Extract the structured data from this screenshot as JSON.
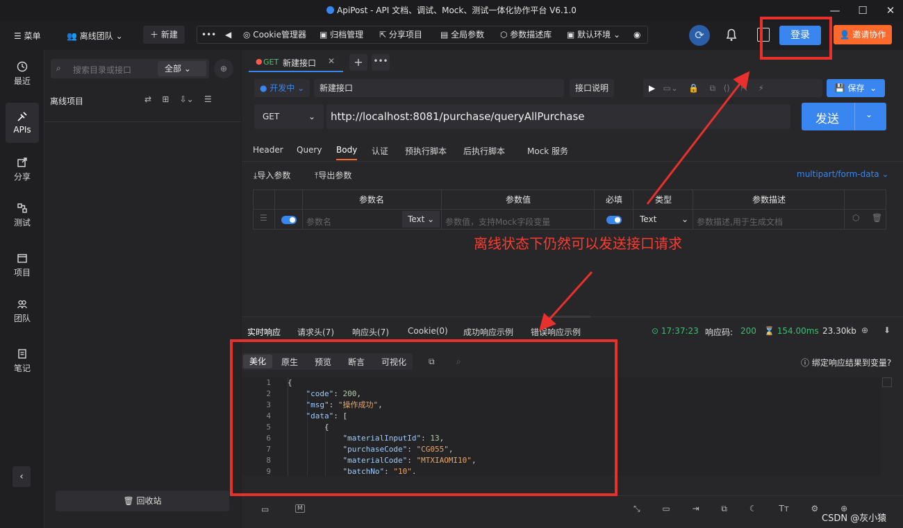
{
  "window": {
    "title": "ApiPost - API 文档、调试、Mock、测试一体化协作平台 V6.1.0"
  },
  "topbar": {
    "menu": "菜单",
    "team": "离线团队",
    "new": "新建",
    "tools": [
      "Cookie管理器",
      "归档管理",
      "分享项目",
      "全局参数",
      "参数描述库",
      "默认环境"
    ],
    "login": "登录",
    "invite": "邀请协作"
  },
  "nav": [
    {
      "label": "最近",
      "icon": "clock-icon"
    },
    {
      "label": "APIs",
      "icon": "apis-icon"
    },
    {
      "label": "分享",
      "icon": "share-icon"
    },
    {
      "label": "测试",
      "icon": "test-icon"
    },
    {
      "label": "项目",
      "icon": "project-icon"
    },
    {
      "label": "团队",
      "icon": "team-icon"
    },
    {
      "label": "笔记",
      "icon": "note-icon"
    }
  ],
  "sidebar": {
    "search_placeholder": "搜索目录或接口",
    "filter": "全部",
    "project": "离线项目",
    "recycle": "回收站"
  },
  "tab": {
    "method": "GET",
    "name": "新建接口"
  },
  "request": {
    "status": "开发中",
    "name": "新建接口",
    "doc_btn": "接口说明",
    "save": "保存",
    "method": "GET",
    "url": "http://localhost:8081/purchase/queryAllPurchase",
    "send": "发送"
  },
  "req_tabs": [
    "Header",
    "Query",
    "Body",
    "认证",
    "预执行脚本",
    "后执行脚本",
    "Mock 服务"
  ],
  "body": {
    "import": "导入参数",
    "export": "导出参数",
    "content_type": "multipart/form-data",
    "headers": [
      "参数名",
      "参数值",
      "必填",
      "类型",
      "参数描述"
    ],
    "row": {
      "name_ph": "参数名",
      "type1": "Text",
      "value_ph": "参数值，支持Mock字段变量",
      "type2": "Text",
      "desc_ph": "参数描述,用于生成文档"
    }
  },
  "annotation": "离线状态下仍然可以发送接口请求",
  "resp_tabs": [
    "实时响应",
    "请求头(7)",
    "响应头(7)",
    "Cookie(0)",
    "成功响应示例",
    "错误响应示例"
  ],
  "resp_meta": {
    "time": "17:37:23",
    "code_label": "响应码:",
    "code": "200",
    "duration": "154.00ms",
    "size": "23.30kb"
  },
  "view_tabs": [
    "美化",
    "原生",
    "预览",
    "断言",
    "可视化"
  ],
  "bind_var": "绑定响应结果到变量?",
  "code_lines": [
    {
      "n": "1",
      "t": "{"
    },
    {
      "n": "2",
      "t": "    \"code\": 200,"
    },
    {
      "n": "3",
      "t": "    \"msg\": \"操作成功\","
    },
    {
      "n": "4",
      "t": "    \"data\": ["
    },
    {
      "n": "5",
      "t": "        {"
    },
    {
      "n": "6",
      "t": "            \"materialInputId\": 13,"
    },
    {
      "n": "7",
      "t": "            \"purchaseCode\": \"CG055\","
    },
    {
      "n": "8",
      "t": "            \"materialCode\": \"MTXIAOMI10\","
    },
    {
      "n": "9",
      "t": "            \"batchNo\": \"10\"."
    }
  ],
  "watermark": "CSDN @灰小猿",
  "colors": {
    "accent": "#3a86f0",
    "orange": "#ff6a2c",
    "annotation": "#e8302c",
    "success": "#38c172"
  }
}
